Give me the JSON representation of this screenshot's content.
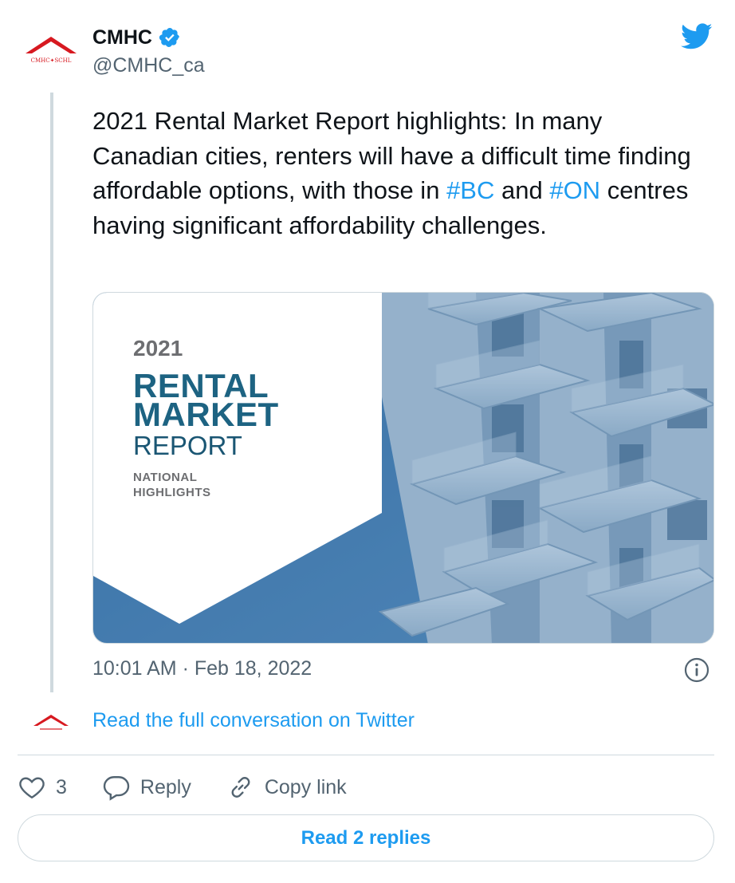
{
  "author": {
    "name": "CMHC",
    "handle": "@CMHC_ca",
    "logo_text": "CMHC✦SCHL",
    "verified": true
  },
  "tweet": {
    "text_parts": [
      "2021 Rental Market Report highlights: In many Canadian cities, renters will have a difficult time finding affordable options, with those in ",
      "#BC",
      " and ",
      "#ON",
      " centres having significant affordability challenges."
    ],
    "timestamp": "10:01 AM · Feb 18, 2022"
  },
  "media": {
    "cover": {
      "year": "2021",
      "line1": "RENTAL",
      "line2": "MARKET",
      "line3": "REPORT",
      "note1": "NATIONAL",
      "note2": "HIGHLIGHTS"
    },
    "icon": "apartment-balconies-photo"
  },
  "conversation": {
    "link_text": "Read the full conversation on Twitter"
  },
  "actions": {
    "like_count": "3",
    "reply_label": "Reply",
    "copy_label": "Copy link"
  },
  "replies": {
    "button_label": "Read 2 replies"
  },
  "colors": {
    "accent": "#1d9bf0",
    "brand_red": "#d71920",
    "cover_blue": "#1d6382",
    "text": "#0f1419",
    "muted": "#536471"
  },
  "icons": {
    "logo": "cmhc-roof-logo-icon",
    "verified": "verified-badge-icon",
    "brand": "twitter-bird-icon",
    "info": "info-icon",
    "like": "heart-icon",
    "reply": "reply-bubble-icon",
    "copy": "link-icon"
  }
}
